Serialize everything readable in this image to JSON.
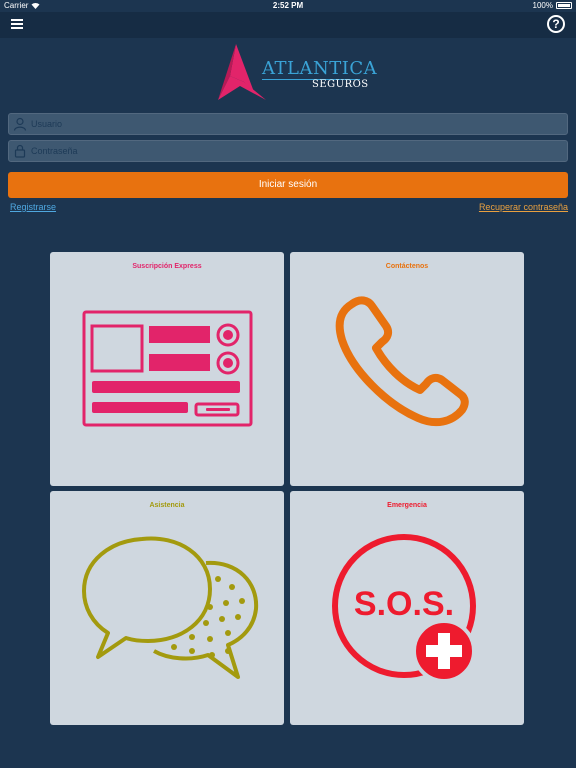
{
  "status_bar": {
    "carrier": "Carrier",
    "time": "2:52 PM",
    "battery": "100%"
  },
  "navbar": {
    "help_label": "?"
  },
  "logo": {
    "name": "ATLANTICA",
    "subtitle": "SEGUROS"
  },
  "login": {
    "username_placeholder": "Usuario",
    "password_placeholder": "Contraseña",
    "submit_label": "Iniciar sesión",
    "register_label": "Registrarse",
    "recover_label": "Recuperar contraseña"
  },
  "tiles": [
    {
      "title": "Suscripción Express",
      "color": "#e2246a",
      "icon": "form-icon"
    },
    {
      "title": "Contáctenos",
      "color": "#e8720f",
      "icon": "phone-icon"
    },
    {
      "title": "Asistencia",
      "color": "#a39a0e",
      "icon": "chat-bubbles-icon"
    },
    {
      "title": "Emergencia",
      "color": "#ee1b2e",
      "icon": "sos-icon",
      "icon_text": "S.O.S."
    }
  ],
  "colors": {
    "background": "#1c3550",
    "navbar": "#162c44",
    "accent": "#e8720f",
    "logo_blue": "#3aa3d6",
    "logo_pink": "#e2246a"
  }
}
